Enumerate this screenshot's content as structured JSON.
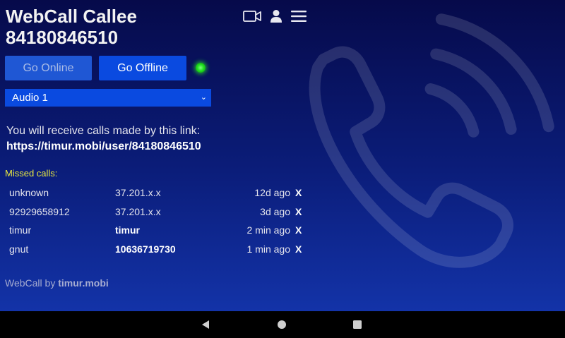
{
  "header": {
    "title": "WebCall Callee",
    "callee_id": "84180846510",
    "icons": [
      "video-camera-icon",
      "user-icon",
      "menu-icon"
    ]
  },
  "controls": {
    "go_online_label": "Go Online",
    "go_offline_label": "Go Offline",
    "status_color": "#20e020",
    "audio_selected": "Audio 1"
  },
  "receive": {
    "text": "You will receive calls made by this link:",
    "link": "https://timur.mobi/user/84180846510"
  },
  "missed": {
    "label": "Missed calls:",
    "rows": [
      {
        "name": "unknown",
        "addr": "37.201.x.x",
        "ago": "12d ago",
        "remove": "X"
      },
      {
        "name": "92929658912",
        "addr": "37.201.x.x",
        "ago": "3d ago",
        "remove": "X"
      },
      {
        "name": "timur",
        "addr": "timur",
        "ago": "2 min ago",
        "remove": "X"
      },
      {
        "name": "gnut",
        "addr": "10636719730",
        "ago": "1 min ago",
        "remove": "X"
      }
    ]
  },
  "footer": {
    "prefix": "WebCall by",
    "brand": "timur.mobi"
  },
  "colors": {
    "background_top": "#060a4a",
    "background_bottom": "#1333a8",
    "button_blue": "#0a4ae0",
    "missed_label": "#e8e840"
  },
  "navbar": {
    "icons": [
      "back-icon",
      "home-icon",
      "recents-icon"
    ]
  }
}
